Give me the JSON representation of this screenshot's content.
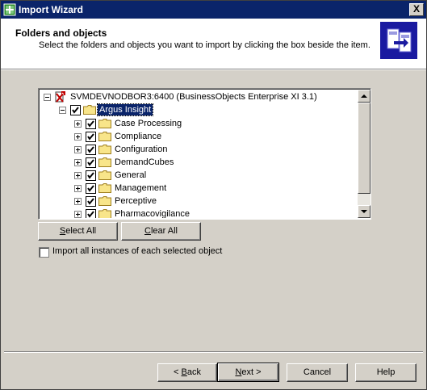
{
  "window": {
    "title": "Import Wizard",
    "close_label": "X"
  },
  "header": {
    "title": "Folders and objects",
    "subtitle": "Select the folders and objects you want to import by clicking the box beside the item."
  },
  "tree": {
    "root": {
      "label": "SVMDEVNODBOR3:6400 (BusinessObjects Enterprise XI 3.1)",
      "checked": true
    },
    "folder": {
      "label": "Argus Insight",
      "checked": true,
      "selected": true
    },
    "children": [
      {
        "label": "Case Processing",
        "checked": true
      },
      {
        "label": "Compliance",
        "checked": true
      },
      {
        "label": "Configuration",
        "checked": true
      },
      {
        "label": "DemandCubes",
        "checked": true
      },
      {
        "label": "General",
        "checked": true
      },
      {
        "label": "Management",
        "checked": true
      },
      {
        "label": "Perceptive",
        "checked": true
      },
      {
        "label": "Pharmacovigilance",
        "checked": true
      }
    ]
  },
  "buttons": {
    "select_all": {
      "first": "S",
      "rest": "elect All"
    },
    "clear_all": {
      "first": "C",
      "rest": "lear All"
    },
    "back": {
      "pre": "< ",
      "u": "B",
      "post": "ack"
    },
    "next": {
      "u": "N",
      "post": "ext >"
    },
    "cancel": "Cancel",
    "help": "Help"
  },
  "import_instances": {
    "label": "Import all instances of each selected object",
    "checked": false
  },
  "colors": {
    "titlebar": "#0a246a",
    "dialog": "#d4d0c8",
    "header_icon": "#1a1aa0",
    "selection": "#0a246a"
  }
}
